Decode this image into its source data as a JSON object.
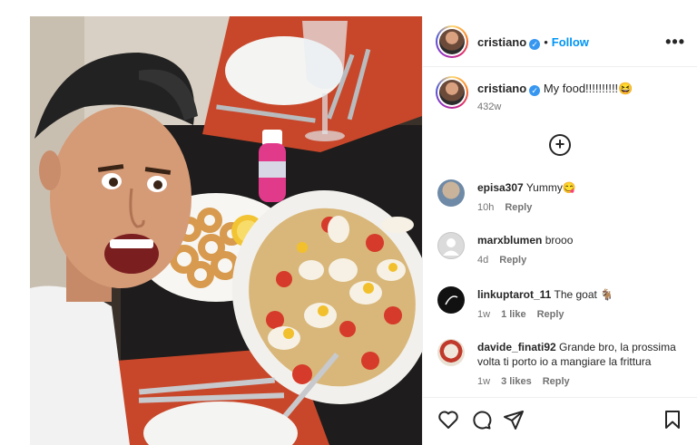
{
  "post": {
    "author": "cristiano",
    "follow_label": "Follow",
    "more_label": "•••",
    "add_comment_label": "+"
  },
  "caption": {
    "user": "cristiano",
    "text": "My food!!!!!!!!!!😆",
    "time": "432w"
  },
  "comments": [
    {
      "user": "episa307",
      "text": "Yummy😋",
      "time": "10h",
      "reply": "Reply",
      "likes": ""
    },
    {
      "user": "marxblumen",
      "text": "brooo",
      "time": "4d",
      "reply": "Reply",
      "likes": ""
    },
    {
      "user": "linkuptarot_11",
      "text": "The goat 🐐",
      "time": "1w",
      "reply": "Reply",
      "likes": "1 like"
    },
    {
      "user": "davide_finati92",
      "text": "Grande bro, la prossima volta ti porto io a mangiare la frittura",
      "time": "1w",
      "reply": "Reply",
      "likes": "3 likes"
    }
  ],
  "colors": {
    "link": "#0095f6",
    "verified": "#3797f0",
    "secondary_text": "#737373"
  },
  "icons": {
    "like": "heart-icon",
    "comment": "comment-icon",
    "share": "share-icon",
    "save": "bookmark-icon"
  }
}
